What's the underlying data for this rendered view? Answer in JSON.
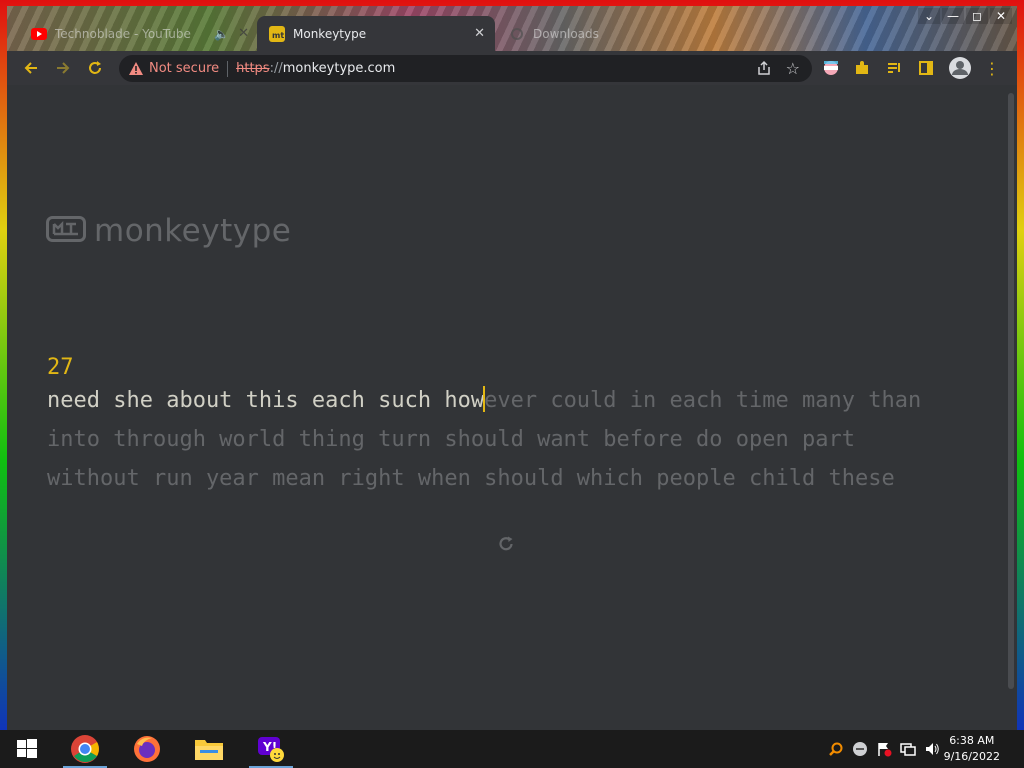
{
  "browser": {
    "tabs": [
      {
        "title": "Technoblade - YouTube",
        "active": false,
        "has_audio": true
      },
      {
        "title": "Monkeytype",
        "active": true
      },
      {
        "title": "Downloads",
        "active": false
      }
    ],
    "security_label": "Not secure",
    "url": {
      "scheme": "https",
      "separator": "://",
      "host": "monkeytype.com"
    }
  },
  "page": {
    "logo_text": "monkeytype",
    "word_counter": "27",
    "typed_text": "need she about this each such how",
    "remaining_line1": "ever could in each time many than",
    "line2": "into through world thing turn should want before do open part",
    "line3": "without run year mean right when should which people child these"
  },
  "taskbar": {
    "apps": [
      "chrome-icon",
      "firefox-icon",
      "file-explorer-icon",
      "yahoo-messenger-icon"
    ],
    "time": "6:38 AM",
    "date": "9/16/2022"
  },
  "colors": {
    "accent": "#e2b714",
    "text": "#d1d0c5",
    "sub": "#646669",
    "bg": "#323437"
  }
}
